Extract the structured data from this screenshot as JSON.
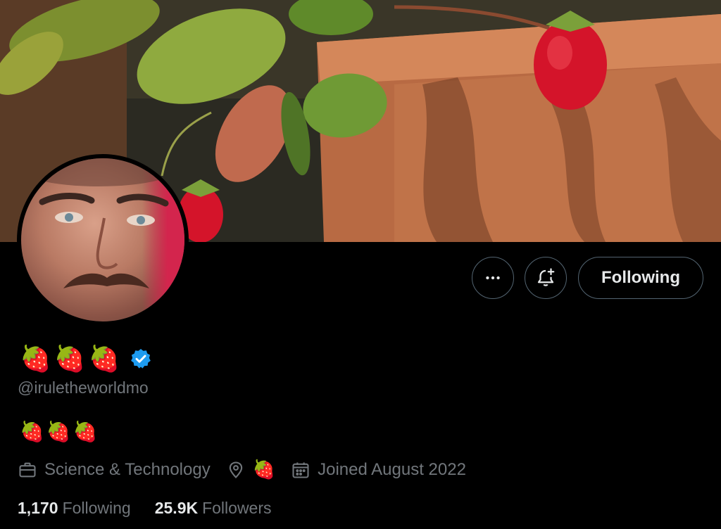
{
  "profile": {
    "display_name": "🍓🍓🍓",
    "handle": "@iruletheworldmo",
    "bio": "🍓🍓🍓",
    "category": "Science & Technology",
    "location": "🍓",
    "joined": "Joined August 2022",
    "verified": true
  },
  "actions": {
    "more_icon": "more-horizontal-icon",
    "bell_icon": "bell-plus-icon",
    "following_label": "Following"
  },
  "stats": {
    "following_count": "1,170",
    "following_label": "Following",
    "followers_count": "25.9K",
    "followers_label": "Followers"
  },
  "colors": {
    "background": "#000000",
    "text_primary": "#e7e9ea",
    "text_secondary": "#71767b",
    "border": "#536471",
    "verified_blue": "#1d9bf0"
  }
}
